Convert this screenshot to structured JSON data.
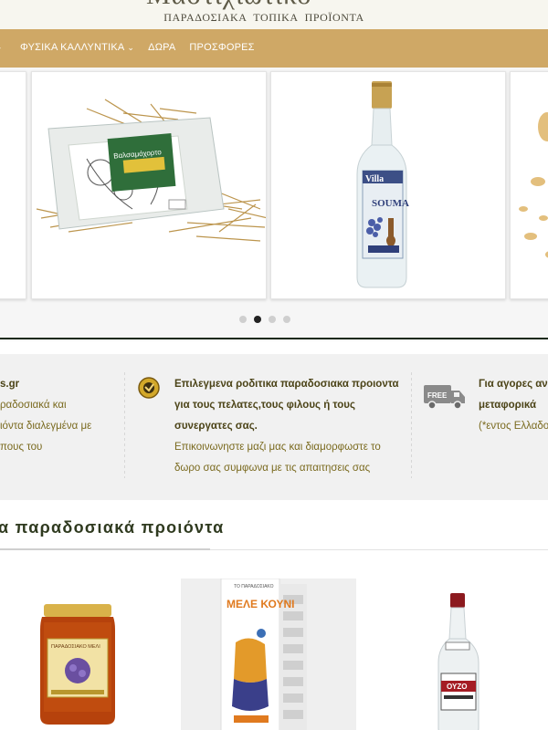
{
  "header": {
    "brand_partial": "Μαστιχιώτικο",
    "tagline": "ΠΑΡΑΔΟΣΙΑΚΑ ΤΟΠΙΚΑ ΠΡΟΪΟΝΤΑ"
  },
  "nav": {
    "items": [
      {
        "label": "ΦΥΣΙΚΑ ΚΑΛΛΥΝΤΙΚΑ",
        "has_dropdown": true
      },
      {
        "label": "ΔΩΡΑ",
        "has_dropdown": false
      },
      {
        "label": "ΠΡΟΣΦΟΡΕΣ",
        "has_dropdown": false
      }
    ],
    "chevron": "⌄"
  },
  "slider": {
    "slides": [
      {
        "name": "herb-package"
      },
      {
        "name": "souma-bottle"
      },
      {
        "name": "cookies-partial"
      }
    ],
    "bottle_label_brand": "Villa",
    "bottle_label_product": "SOUMA",
    "herb_label": "Βαλσαμόχορτο",
    "dots": [
      false,
      true,
      false,
      false
    ]
  },
  "info": {
    "col1": {
      "head": "s.gr",
      "lines": [
        "ραδοσιακά και",
        "ιόντα διαλεγμένα με",
        "πους του"
      ]
    },
    "col2": {
      "head_lines": [
        "Επιλεγμενα ροδιτικα παραδοσιακα προιοντα",
        "για τους πελατες,τους φιλους ή τους",
        "συνεργατες σας."
      ],
      "lines": [
        "Επικοινωνηστε μαζι μας και διαμορφωστε το",
        "δωρο σας συμφωνα με τις απαιτησεις σας"
      ]
    },
    "col3": {
      "head_lines": [
        "Για αγορες ανω",
        "μεταφορικά"
      ],
      "lines": [
        "(*εντος Ελλαδος"
      ],
      "truck_label": "FREE"
    }
  },
  "section": {
    "title": "α παραδοσιακά προιόντα"
  },
  "products": {
    "honey_label": "ΠΑΡΑΔΟΣΙΑΚΟ ΜΕΛΙ",
    "melekouni_top": "ΤΟ ΠΑΡΑΔΟΣΙΑΚΟ",
    "melekouni_brand": "ΜΕΛΕ ΚΟΥΝΙ",
    "ouzo_label": "ΟΥΖΟ"
  },
  "colors": {
    "nav_bg": "#cfa866",
    "header_bg": "#f7f6ef",
    "info_bg": "#f1f1f1",
    "info_text": "#7a6a1f",
    "title_text": "#2f3a1f"
  }
}
